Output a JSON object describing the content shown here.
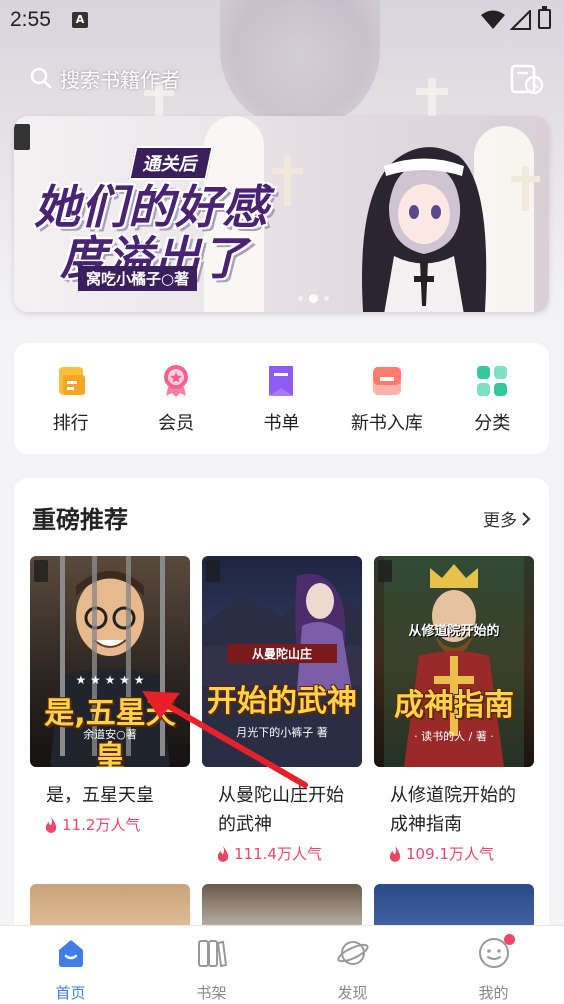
{
  "status_bar": {
    "time": "2:55",
    "notif_badge": "A"
  },
  "search": {
    "placeholder": "搜索书籍作者"
  },
  "banner": {
    "tag": "通关后",
    "title_line1": "她们的好感",
    "title_line2": "度溢出了",
    "author": "窝吃小橘子○著",
    "dots": 3,
    "active_dot": 1
  },
  "quick_nav": {
    "items": [
      {
        "label": "排行",
        "icon": "ranking-icon",
        "color": "#f5a623"
      },
      {
        "label": "会员",
        "icon": "vip-badge-icon",
        "color": "#f3628a"
      },
      {
        "label": "书单",
        "icon": "booklist-bookmark-icon",
        "color": "#8e5cf0"
      },
      {
        "label": "新书入库",
        "icon": "new-book-icon",
        "color": "#ff7a6b"
      },
      {
        "label": "分类",
        "icon": "category-grid-icon",
        "color": "#34c7a0"
      }
    ]
  },
  "recommend": {
    "title": "重磅推荐",
    "more": "更多",
    "books": [
      {
        "name": "是，五星天皇",
        "popularity": "11.2万人气",
        "cover_title": "是,五星天皇",
        "cover_author": "余道安○著"
      },
      {
        "name": "从曼陀山庄开始的武神",
        "popularity": "111.4万人气",
        "cover_tag": "从曼陀山庄",
        "cover_title": "开始的武神",
        "cover_author": "月光下的小裤子 著"
      },
      {
        "name": "从修道院开始的成神指南",
        "popularity": "109.1万人气",
        "cover_tag": "从修道院开始的",
        "cover_title": "成神指南",
        "cover_author": "· 读书的人 / 著 ·"
      }
    ]
  },
  "tabbar": {
    "tabs": [
      {
        "label": "首页",
        "active": true
      },
      {
        "label": "书架",
        "active": false
      },
      {
        "label": "发现",
        "active": false
      },
      {
        "label": "我的",
        "active": false
      }
    ]
  },
  "colors": {
    "accent": "#3f7ee8",
    "popularity": "#e8476a",
    "badge": "#f0436b"
  }
}
